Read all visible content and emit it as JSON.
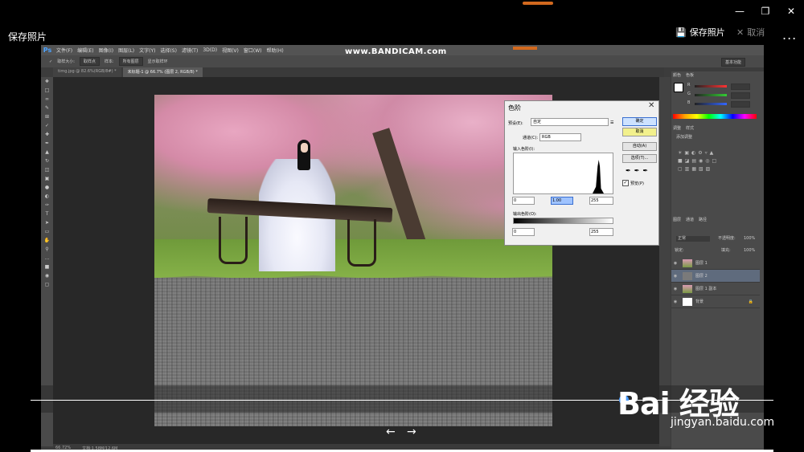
{
  "viewer": {
    "title": "保存照片",
    "save_label": "保存照片",
    "cancel_label": "取消",
    "more": "..."
  },
  "ps": {
    "logo": "Ps",
    "menu": [
      "文件(F)",
      "编辑(E)",
      "图像(I)",
      "图层(L)",
      "文字(Y)",
      "选择(S)",
      "滤镜(T)",
      "3D(D)",
      "视图(V)",
      "窗口(W)",
      "帮助(H)"
    ],
    "watermark": "www.BANDICAM.com",
    "options": {
      "tool_size_label": "取样大小:",
      "tool_size_value": "取样点",
      "sample_label": "样本:",
      "sample_value": "所有图层",
      "show_ring": "显示取样环"
    },
    "workspace": "基本功能",
    "tabs": [
      "timg.jpg @ 82.6%(RGB/8#) *",
      "未标题-1 @ 66.7% (图层 2, RGB/8) *"
    ],
    "status": {
      "zoom": "66.72%",
      "doc": "文档:1.58M/12.6M"
    }
  },
  "levels": {
    "title": "色阶",
    "preset_label": "预设(E):",
    "preset_value": "自定",
    "channel_label": "通道(C):",
    "channel_value": "RGB",
    "input_label": "输入色阶(I):",
    "input_black": "0",
    "input_gamma": "1.00",
    "input_white": "255",
    "output_label": "输出色阶(O):",
    "output_black": "0",
    "output_white": "255",
    "ok": "确定",
    "cancel": "取消",
    "auto": "自动(A)",
    "options": "选项(T)...",
    "preview": "预览(P)"
  },
  "panels": {
    "color_tabs": [
      "颜色",
      "色板"
    ],
    "sliders": [
      {
        "label": "R",
        "color": "#ff3333"
      },
      {
        "label": "G",
        "color": "#33cc33"
      },
      {
        "label": "B",
        "color": "#3366ff"
      }
    ],
    "adjust_tabs": [
      "调整",
      "样式"
    ],
    "adjust_hint": "添加调整",
    "layer_tabs": [
      "图层",
      "通道",
      "路径"
    ],
    "blend_mode": "正常",
    "opacity_label": "不透明度:",
    "opacity_value": "100%",
    "lock_label": "锁定:",
    "fill_label": "填充:",
    "fill_value": "100%",
    "layers": [
      {
        "name": "图层 1",
        "selected": false
      },
      {
        "name": "图层 2",
        "selected": true
      },
      {
        "name": "图层 1 副本",
        "selected": false
      },
      {
        "name": "背景",
        "selected": false
      }
    ]
  },
  "overlay": {
    "baidu": "Bai 经验",
    "url": "jingyan.baidu.com"
  },
  "colors": {
    "accent": "#4a9cff",
    "progress": "#d2691e",
    "ok_button": "#cde2ff",
    "cancel_button": "#f2f08c"
  }
}
